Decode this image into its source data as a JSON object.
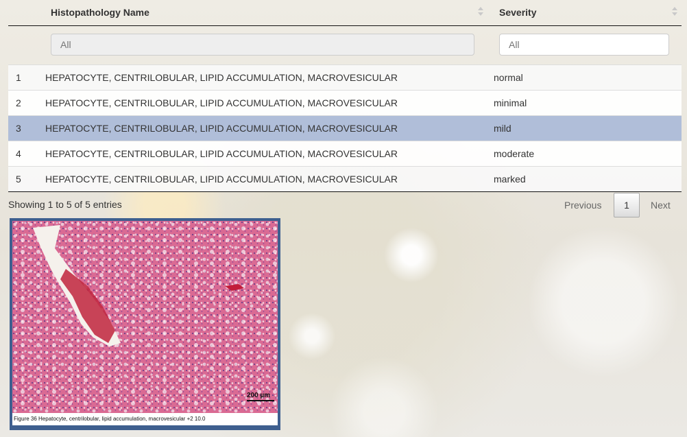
{
  "table": {
    "headers": {
      "name": "Histopathology Name",
      "severity": "Severity"
    },
    "filters": {
      "name_placeholder": "All",
      "severity_placeholder": "All"
    },
    "rows": [
      {
        "index": "1",
        "name": "HEPATOCYTE, CENTRILOBULAR, LIPID ACCUMULATION, MACROVESICULAR",
        "severity": "normal"
      },
      {
        "index": "2",
        "name": "HEPATOCYTE, CENTRILOBULAR, LIPID ACCUMULATION, MACROVESICULAR",
        "severity": "minimal"
      },
      {
        "index": "3",
        "name": "HEPATOCYTE, CENTRILOBULAR, LIPID ACCUMULATION, MACROVESICULAR",
        "severity": "mild"
      },
      {
        "index": "4",
        "name": "HEPATOCYTE, CENTRILOBULAR, LIPID ACCUMULATION, MACROVESICULAR",
        "severity": "moderate"
      },
      {
        "index": "5",
        "name": "HEPATOCYTE, CENTRILOBULAR, LIPID ACCUMULATION, MACROVESICULAR",
        "severity": "marked"
      }
    ],
    "selected_row": "3",
    "info": "Showing 1 to 5 of 5 entries"
  },
  "pagination": {
    "previous": "Previous",
    "current": "1",
    "next": "Next"
  },
  "figure": {
    "caption": "Figure 36    Hepatocyte, centrilobular, lipid accumulation, macrovesicular +2     10.0",
    "scale_label": "200 µm"
  },
  "colors": {
    "selected_row": "#b0bed9",
    "figure_border": "#3e5f8f",
    "tissue": "#d9688f"
  }
}
